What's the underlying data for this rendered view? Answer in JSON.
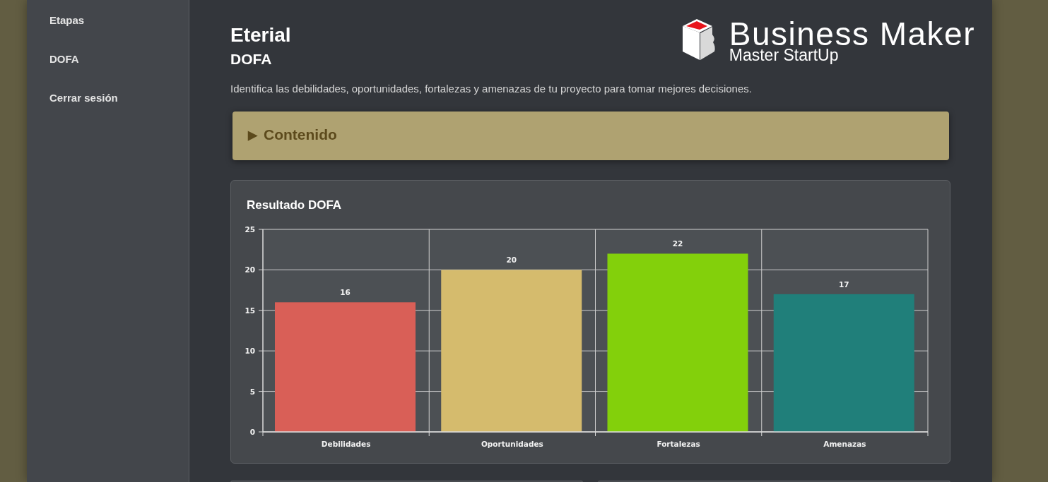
{
  "sidebar": {
    "items": [
      {
        "label": "Etapas"
      },
      {
        "label": "DOFA"
      },
      {
        "label": "Cerrar sesión"
      }
    ]
  },
  "header": {
    "title": "Eterial",
    "subtitle": "DOFA",
    "brand": {
      "name": "Business Maker",
      "tagline": "Master StartUp"
    }
  },
  "description": "Identifica las debilidades, oportunidades, fortalezas y amenazas de tu proyecto para tomar mejores decisiones.",
  "accordion": {
    "marker": "▶",
    "label": "Contenido",
    "expanded": false
  },
  "result_card": {
    "title": "Resultado DOFA",
    "chart_data": {
      "type": "bar",
      "categories": [
        "Debilidades",
        "Oportunidades",
        "Fortalezas",
        "Amenazas"
      ],
      "values": [
        16,
        20,
        22,
        17
      ],
      "colors": [
        "#d95f57",
        "#d5bb6d",
        "#83d00b",
        "#207f7a"
      ],
      "ylim": [
        0,
        25
      ],
      "yticks": [
        0,
        5,
        10,
        15,
        20,
        25
      ],
      "grid": true,
      "data_labels": true
    }
  }
}
